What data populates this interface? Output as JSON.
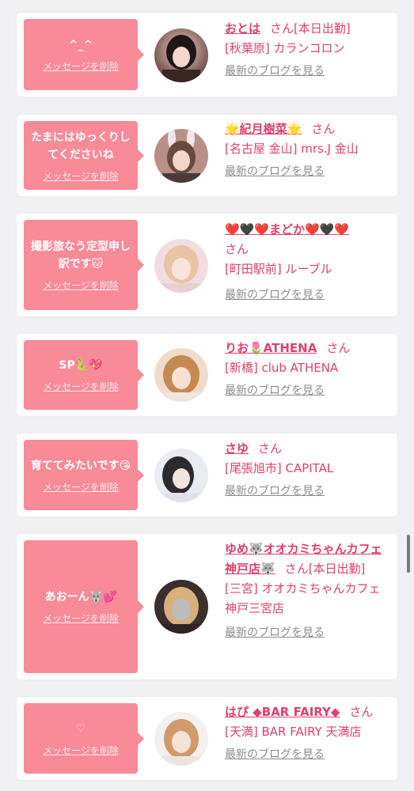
{
  "delete_label": "メッセージを削除",
  "blog_label": "最新のブログを見る",
  "colors": {
    "bubble": "#f98a98",
    "name": "#e0406a",
    "link_gray": "#8c8c8c",
    "background": "#f1f1f3"
  },
  "cards": [
    {
      "message": "^_^",
      "name": "おとは",
      "honorific": "さん",
      "status": "[本日出勤]",
      "shop": "[秋葉原] カランコロン",
      "avatar_icon": "girl-photo-avatar"
    },
    {
      "message": "たまにはゆっくりしてくださいね",
      "name": "🌟紀月樹菜🌟",
      "honorific": "さん",
      "status": "",
      "shop": "[名古屋 金山] mrs.J 金山",
      "avatar_icon": "girl-photo-avatar"
    },
    {
      "message": "撮影旅なう定型申し訳です🐱",
      "name": "❤️🖤❤️まどか❤️🖤❤️",
      "honorific": "さん",
      "status": "",
      "shop": "[町田駅前] ルーブル",
      "avatar_icon": "girl-photo-avatar"
    },
    {
      "message": "SP🐍💖",
      "name": "りお🌷ATHENA",
      "honorific": "さん",
      "status": "",
      "shop": "[新橋] club ATHENA",
      "avatar_icon": "girl-photo-avatar"
    },
    {
      "message": "育ててみたいです😘",
      "name": "さゆ",
      "honorific": "さん",
      "status": "",
      "shop": "[尾張旭市] CAPITAL",
      "avatar_icon": "girl-photo-avatar"
    },
    {
      "message": "あおーん🐺💕",
      "name": "ゆめ🐺オオカミちゃんカフェ神戸店🐺",
      "honorific": "さん",
      "status": "[本日出勤]",
      "shop": "[三宮] オオカミちゃんカフェ神戸三宮店",
      "avatar_icon": "girl-photo-avatar"
    },
    {
      "message": "♡",
      "name": "はぴ ◆BAR FAIRY◆",
      "honorific": "さん",
      "status": "",
      "shop": "[天満] BAR FAIRY 天満店",
      "avatar_icon": "girl-photo-avatar"
    }
  ]
}
